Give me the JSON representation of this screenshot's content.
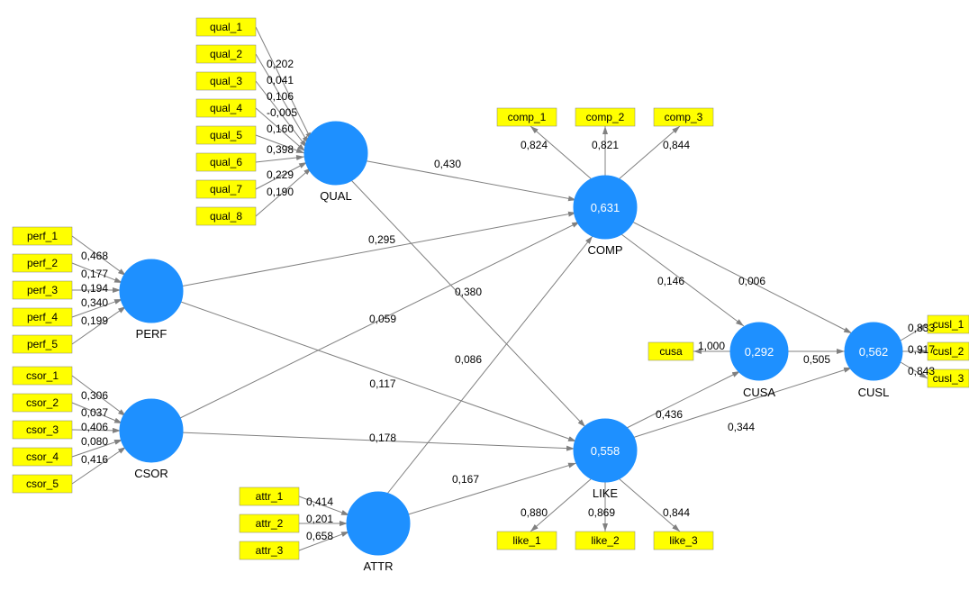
{
  "constructs": {
    "QUAL": {
      "label": "QUAL",
      "value": null
    },
    "PERF": {
      "label": "PERF",
      "value": null
    },
    "CSOR": {
      "label": "CSOR",
      "value": null
    },
    "ATTR": {
      "label": "ATTR",
      "value": null
    },
    "COMP": {
      "label": "COMP",
      "value": "0,631"
    },
    "LIKE": {
      "label": "LIKE",
      "value": "0,558"
    },
    "CUSA": {
      "label": "CUSA",
      "value": "0,292"
    },
    "CUSL": {
      "label": "CUSL",
      "value": "0,562"
    }
  },
  "indicators": {
    "qual_1": "qual_1",
    "qual_2": "qual_2",
    "qual_3": "qual_3",
    "qual_4": "qual_4",
    "qual_5": "qual_5",
    "qual_6": "qual_6",
    "qual_7": "qual_7",
    "qual_8": "qual_8",
    "perf_1": "perf_1",
    "perf_2": "perf_2",
    "perf_3": "perf_3",
    "perf_4": "perf_4",
    "perf_5": "perf_5",
    "csor_1": "csor_1",
    "csor_2": "csor_2",
    "csor_3": "csor_3",
    "csor_4": "csor_4",
    "csor_5": "csor_5",
    "attr_1": "attr_1",
    "attr_2": "attr_2",
    "attr_3": "attr_3",
    "comp_1": "comp_1",
    "comp_2": "comp_2",
    "comp_3": "comp_3",
    "like_1": "like_1",
    "like_2": "like_2",
    "like_3": "like_3",
    "cusa": "cusa",
    "cusl_1": "cusl_1",
    "cusl_2": "cusl_2",
    "cusl_3": "cusl_3"
  },
  "outer_weights": {
    "qual_1": "0,202",
    "qual_2": "0,041",
    "qual_3": "0,106",
    "qual_4": "-0,005",
    "qual_5": "0,160",
    "qual_6": "0,398",
    "qual_7": "0,229",
    "qual_8": "0,190",
    "perf_1": "0,468",
    "perf_2": "0,177",
    "perf_3": "0,194",
    "perf_4": "0,340",
    "perf_5": "0,199",
    "csor_1": "0,306",
    "csor_2": "0,037",
    "csor_3": "0,406",
    "csor_4": "0,080",
    "csor_5": "0,416",
    "attr_1": "0,414",
    "attr_2": "0,201",
    "attr_3": "0,658",
    "comp_1": "0,824",
    "comp_2": "0,821",
    "comp_3": "0,844",
    "like_1": "0,880",
    "like_2": "0,869",
    "like_3": "0,844",
    "cusa": "1,000",
    "cusl_1": "0,833",
    "cusl_2": "0,917",
    "cusl_3": "0,843"
  },
  "paths": {
    "QUAL_COMP": "0,430",
    "QUAL_LIKE": "0,380",
    "PERF_COMP": "0,295",
    "PERF_LIKE": "0,117",
    "CSOR_COMP": "0,059",
    "CSOR_LIKE": "0,178",
    "ATTR_COMP": "0,086",
    "ATTR_LIKE": "0,167",
    "COMP_CUSA": "0,146",
    "COMP_CUSL": "0,006",
    "LIKE_CUSA": "0,436",
    "LIKE_CUSL": "0,344",
    "CUSA_CUSL": "0,505"
  },
  "chart_data": {
    "type": "path-diagram",
    "description": "Structural equation model (PLS path model) with latent constructs QUAL, PERF, CSOR, ATTR as formative exogenous constructs predicting reflective constructs COMP and LIKE, which predict CUSA and CUSL.",
    "constructs": [
      {
        "name": "QUAL",
        "r2": null,
        "indicators": [
          {
            "name": "qual_1",
            "weight": 0.202
          },
          {
            "name": "qual_2",
            "weight": 0.041
          },
          {
            "name": "qual_3",
            "weight": 0.106
          },
          {
            "name": "qual_4",
            "weight": -0.005
          },
          {
            "name": "qual_5",
            "weight": 0.16
          },
          {
            "name": "qual_6",
            "weight": 0.398
          },
          {
            "name": "qual_7",
            "weight": 0.229
          },
          {
            "name": "qual_8",
            "weight": 0.19
          }
        ]
      },
      {
        "name": "PERF",
        "r2": null,
        "indicators": [
          {
            "name": "perf_1",
            "weight": 0.468
          },
          {
            "name": "perf_2",
            "weight": 0.177
          },
          {
            "name": "perf_3",
            "weight": 0.194
          },
          {
            "name": "perf_4",
            "weight": 0.34
          },
          {
            "name": "perf_5",
            "weight": 0.199
          }
        ]
      },
      {
        "name": "CSOR",
        "r2": null,
        "indicators": [
          {
            "name": "csor_1",
            "weight": 0.306
          },
          {
            "name": "csor_2",
            "weight": 0.037
          },
          {
            "name": "csor_3",
            "weight": 0.406
          },
          {
            "name": "csor_4",
            "weight": 0.08
          },
          {
            "name": "csor_5",
            "weight": 0.416
          }
        ]
      },
      {
        "name": "ATTR",
        "r2": null,
        "indicators": [
          {
            "name": "attr_1",
            "weight": 0.414
          },
          {
            "name": "attr_2",
            "weight": 0.201
          },
          {
            "name": "attr_3",
            "weight": 0.658
          }
        ]
      },
      {
        "name": "COMP",
        "r2": 0.631,
        "indicators": [
          {
            "name": "comp_1",
            "loading": 0.824
          },
          {
            "name": "comp_2",
            "loading": 0.821
          },
          {
            "name": "comp_3",
            "loading": 0.844
          }
        ]
      },
      {
        "name": "LIKE",
        "r2": 0.558,
        "indicators": [
          {
            "name": "like_1",
            "loading": 0.88
          },
          {
            "name": "like_2",
            "loading": 0.869
          },
          {
            "name": "like_3",
            "loading": 0.844
          }
        ]
      },
      {
        "name": "CUSA",
        "r2": 0.292,
        "indicators": [
          {
            "name": "cusa",
            "loading": 1.0
          }
        ]
      },
      {
        "name": "CUSL",
        "r2": 0.562,
        "indicators": [
          {
            "name": "cusl_1",
            "loading": 0.833
          },
          {
            "name": "cusl_2",
            "loading": 0.917
          },
          {
            "name": "cusl_3",
            "loading": 0.843
          }
        ]
      }
    ],
    "structural_paths": [
      {
        "from": "QUAL",
        "to": "COMP",
        "coef": 0.43
      },
      {
        "from": "QUAL",
        "to": "LIKE",
        "coef": 0.38
      },
      {
        "from": "PERF",
        "to": "COMP",
        "coef": 0.295
      },
      {
        "from": "PERF",
        "to": "LIKE",
        "coef": 0.117
      },
      {
        "from": "CSOR",
        "to": "COMP",
        "coef": 0.059
      },
      {
        "from": "CSOR",
        "to": "LIKE",
        "coef": 0.178
      },
      {
        "from": "ATTR",
        "to": "COMP",
        "coef": 0.086
      },
      {
        "from": "ATTR",
        "to": "LIKE",
        "coef": 0.167
      },
      {
        "from": "COMP",
        "to": "CUSA",
        "coef": 0.146
      },
      {
        "from": "COMP",
        "to": "CUSL",
        "coef": 0.006
      },
      {
        "from": "LIKE",
        "to": "CUSA",
        "coef": 0.436
      },
      {
        "from": "LIKE",
        "to": "CUSL",
        "coef": 0.344
      },
      {
        "from": "CUSA",
        "to": "CUSL",
        "coef": 0.505
      }
    ]
  }
}
